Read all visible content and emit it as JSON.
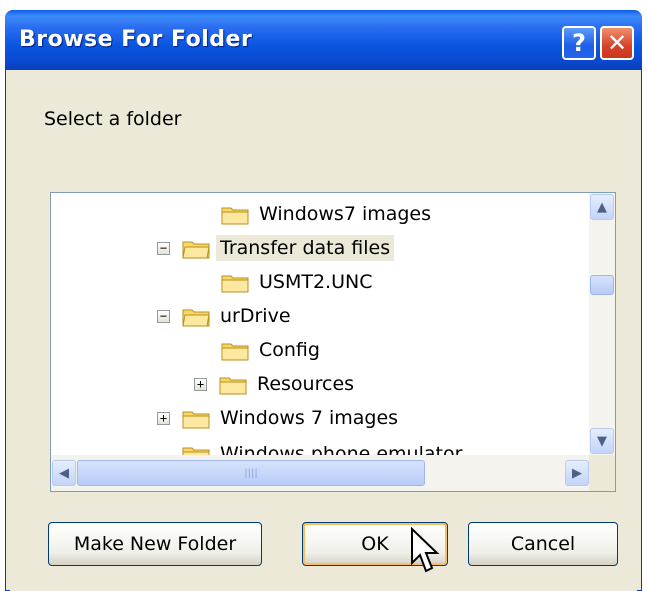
{
  "window": {
    "title": "Browse For Folder",
    "help_label": "?",
    "close_label": "✕"
  },
  "prompt": "Select a folder",
  "tree": {
    "items": [
      {
        "label": "Windows7 images",
        "expander": ""
      },
      {
        "label": "Transfer data files",
        "expander": "−",
        "selected": true
      },
      {
        "label": "USMT2.UNC",
        "expander": ""
      },
      {
        "label": "urDrive",
        "expander": "−"
      },
      {
        "label": "Config",
        "expander": ""
      },
      {
        "label": "Resources",
        "expander": "+"
      },
      {
        "label": "Windows 7 images",
        "expander": "+"
      },
      {
        "label": "Windows phone emulator",
        "expander": ""
      }
    ]
  },
  "scroll": {
    "up": "▲",
    "down": "▼",
    "left": "◀",
    "right": "▶",
    "grip": "||||"
  },
  "buttons": {
    "new_folder": "Make New Folder",
    "ok": "OK",
    "cancel": "Cancel"
  },
  "colors": {
    "title_blue": "#0A49D0",
    "folder_yellow": "#F7D768",
    "dialog_bg": "#ECE9D8"
  }
}
